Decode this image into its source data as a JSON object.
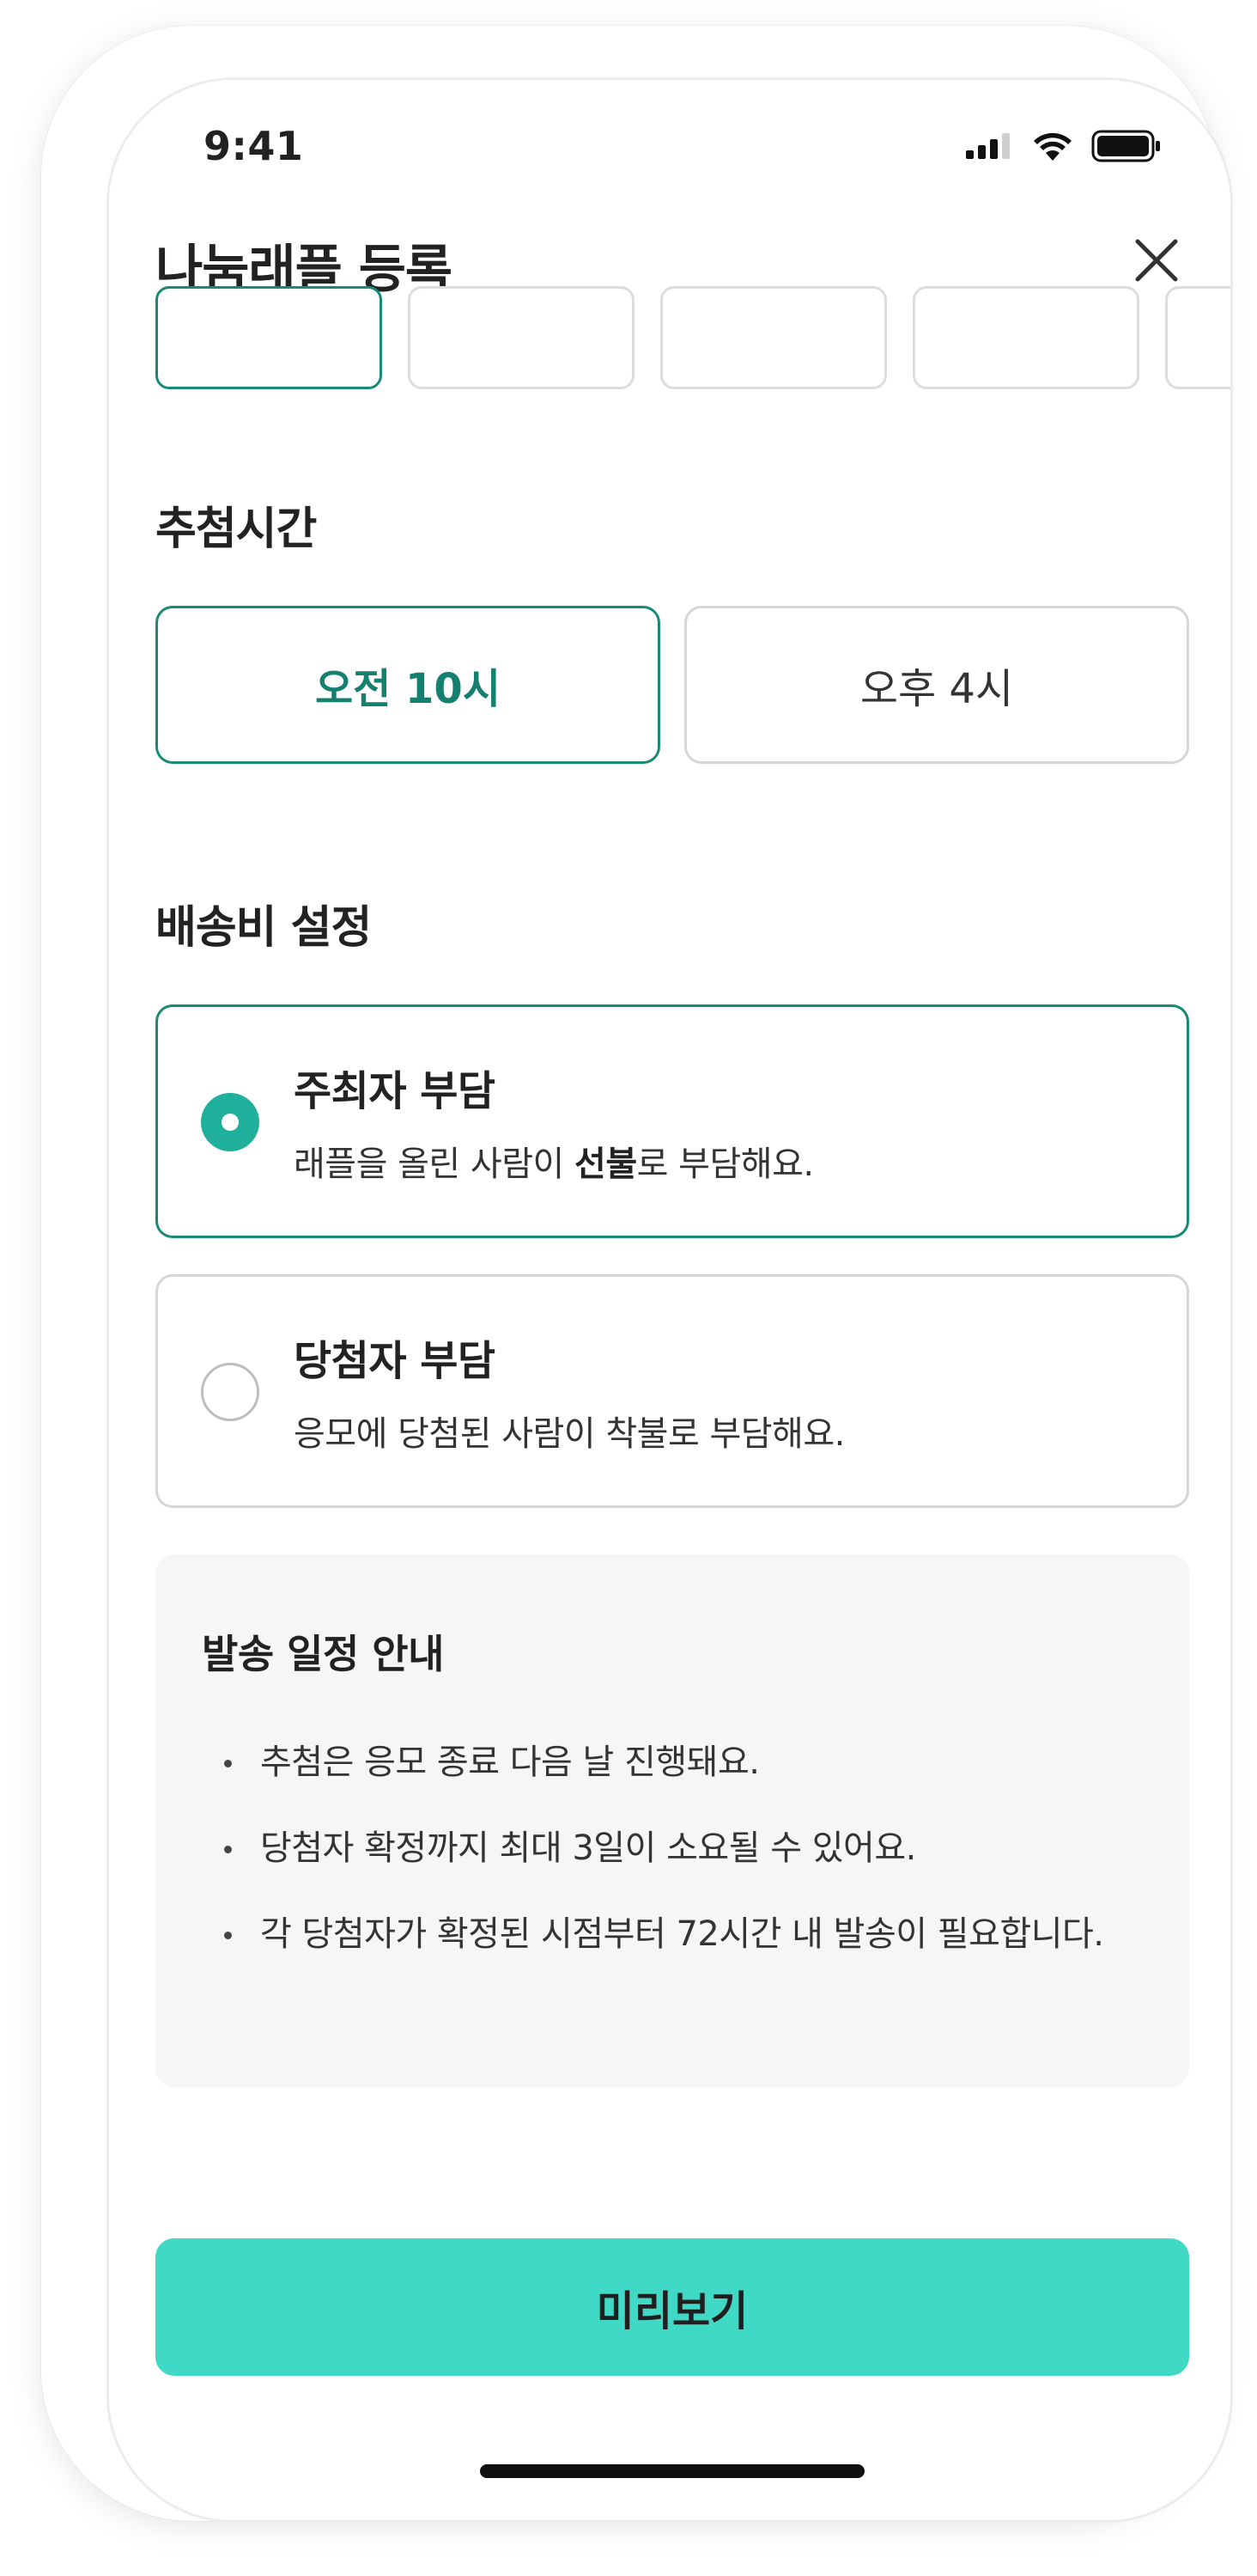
{
  "status_bar": {
    "time": "9:41"
  },
  "header": {
    "title": "나눔래플 등록"
  },
  "draw_time": {
    "title": "추첨시간",
    "options": [
      {
        "label": "오전 10시",
        "selected": true
      },
      {
        "label": "오후 4시",
        "selected": false
      }
    ]
  },
  "shipping": {
    "title": "배송비 설정",
    "options": [
      {
        "title": "주최자 부담",
        "desc_before": "래플을 올린 사람이 ",
        "desc_bold": "선불",
        "desc_after": "로 부담해요.",
        "selected": true
      },
      {
        "title": "당첨자 부담",
        "desc": "응모에 당첨된 사람이 착불로 부담해요.",
        "selected": false
      }
    ]
  },
  "info": {
    "title": "발송 일정 안내",
    "items": [
      "추첨은 응모 종료 다음 날 진행돼요.",
      "당첨자 확정까지 최대 3일이 소요될 수 있어요.",
      "각 당첨자가 확정된 시점부터 72시간 내 발송이 필요합니다."
    ]
  },
  "cta": {
    "label": "미리보기"
  },
  "colors": {
    "accent": "#1a8a78",
    "radio_checked": "#1fb09c",
    "cta_bg": "#40d9c5",
    "info_bg": "#f5f7f6"
  },
  "icons": {
    "close": "close-icon",
    "signal": "cellular-signal-icon",
    "wifi": "wifi-icon",
    "battery": "battery-icon"
  }
}
